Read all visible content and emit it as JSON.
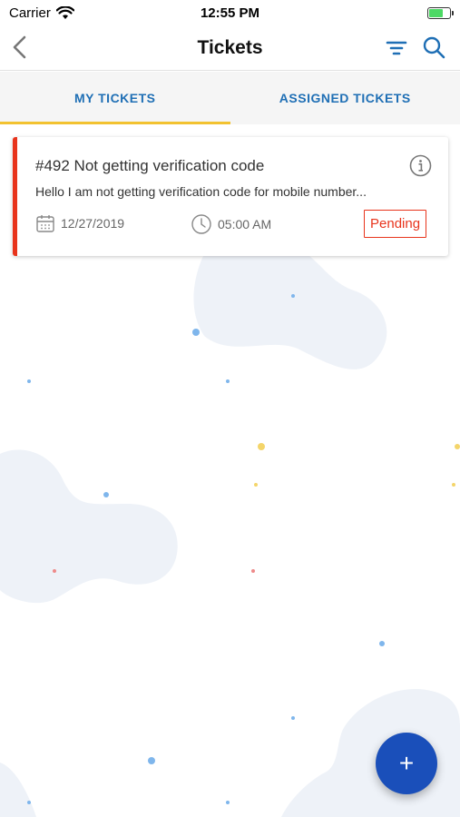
{
  "status_bar": {
    "carrier": "Carrier",
    "time": "12:55 PM"
  },
  "header": {
    "title": "Tickets",
    "back_icon": "chevron-left-icon",
    "filter_icon": "filter-icon",
    "search_icon": "search-icon",
    "accent_color": "#1f6fb5"
  },
  "tabs": [
    {
      "label": "MY TICKETS",
      "active": true
    },
    {
      "label": "ASSIGNED TICKETS",
      "active": false
    }
  ],
  "tickets": [
    {
      "title": "#492 Not getting verification code",
      "description": "Hello I am not getting verification code for mobile number...",
      "date": "12/27/2019",
      "time": "05:00 AM",
      "status": "Pending",
      "status_color": "#e8341c"
    }
  ],
  "fab": {
    "label": "+",
    "color": "#1a4fba"
  }
}
